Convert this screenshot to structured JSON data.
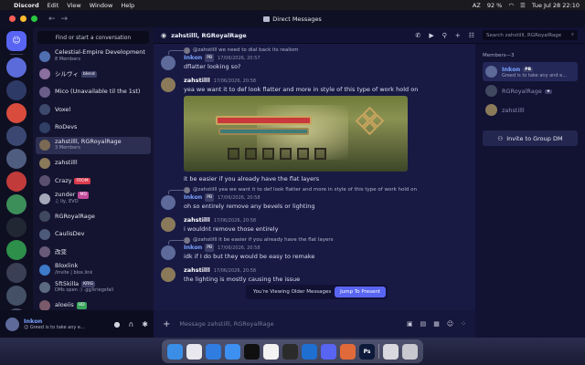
{
  "menubar": {
    "app": "Discord",
    "items": [
      "Edit",
      "View",
      "Window",
      "Help"
    ],
    "battery": "92 %",
    "input_source": "AZ",
    "datetime": "Tue Jul 28  22:10"
  },
  "window": {
    "title": "Direct Messages",
    "traffic": [
      "#ff5f57",
      "#febc2e",
      "#28c840"
    ]
  },
  "sidebar": {
    "find_label": "Find or start a conversation",
    "dms": [
      {
        "name": "Celestial-Empire Development",
        "sub": "8 Members",
        "color": "#4f6fb0"
      },
      {
        "name": "シルヴィ",
        "badge": "blend",
        "badge_style": "",
        "sub": "",
        "color": "#8b6f9e"
      },
      {
        "name": "Mico (Unavailable til the 1st)",
        "sub": "",
        "color": "#6a5d88"
      },
      {
        "name": "Voxel",
        "sub": "",
        "color": "#3d4a6e"
      },
      {
        "name": "RoDevs",
        "sub": "",
        "color": "#2f3f66"
      },
      {
        "name": "zahstilll, RGRoyalRage",
        "sub": "3 Members",
        "color": "#7a6a55"
      },
      {
        "name": "zahstilll",
        "sub": "",
        "color": "#8a7a5a"
      },
      {
        "name": "Crazy",
        "badge": "FROM",
        "badge_style": "red",
        "sub": "",
        "color": "#5a4f6f"
      },
      {
        "name": "zunder",
        "badge": "MD",
        "badge_style": "pink",
        "sub": "♫ Ily, EVO",
        "color": "#a5a8b8"
      },
      {
        "name": "RGRoyalRage",
        "sub": "",
        "color": "#404860"
      },
      {
        "name": "CaulisDev",
        "sub": "",
        "color": "#4d5a7a"
      },
      {
        "name": "改变",
        "sub": "",
        "color": "#6a5a7a"
      },
      {
        "name": "Bloxlink",
        "sub": "/invite | blox.link",
        "color": "#3d7ac9"
      },
      {
        "name": "5ft5killa",
        "badge": "KRIG",
        "badge_style": "",
        "sub": "DMs open :) .gg/kriegsfall",
        "color": "#5a6a80"
      },
      {
        "name": "aloeiis",
        "badge": "HD",
        "badge_style": "green",
        "sub": "",
        "color": "#7a5a6a"
      }
    ]
  },
  "guilds": [
    "#5b6bd9",
    "#2e3a66",
    "#d94c3d",
    "#3b4770",
    "#4f5d80",
    "#c23b3b",
    "#3d8f5a",
    "#222833",
    "#2d8f4a",
    "#3a3f55",
    "#445066",
    "#4a4f6a",
    "#2c2f44",
    "#58627d"
  ],
  "user": {
    "name": "Inkon",
    "status": "Greed is to take any e..."
  },
  "chat_header": {
    "title": "zahstilll, RGRoyalRage",
    "search_placeholder": "Search zahstilll, RGRoyalRage"
  },
  "messages": [
    {
      "reply": "@zahstilll we need to dial back its realism",
      "author": "Inkon",
      "author_blue": true,
      "badge": "PB",
      "ts": "17/06/2026, 20:57",
      "text": "dflatter looking so?",
      "av": "#5d6a9a"
    },
    {
      "author": "zahstilll",
      "ts": "17/06/2026, 20:58",
      "text": "yea we want it to def look flatter and more in style of this type of work hold on",
      "av": "#8a7a5a",
      "image": true,
      "after": "it be easier if you already have the flat layers"
    },
    {
      "reply": "@zahstilll yea we want it to def look flatter and more in style of this type of work hold on",
      "author": "Inkon",
      "author_blue": true,
      "badge": "PB",
      "ts": "17/06/2026, 20:58",
      "text": "oh so entirely remove any bevels or lighting",
      "av": "#5d6a9a"
    },
    {
      "author": "zahstilll",
      "ts": "17/06/2026, 20:58",
      "text": "i wouldnt remove those entirely",
      "av": "#8a7a5a"
    },
    {
      "reply": "@zahstilll it be easier if you already have the flat layers",
      "author": "Inkon",
      "author_blue": true,
      "badge": "PB",
      "ts": "17/06/2026, 20:58",
      "text": "idk if I do but they would be easy to remake",
      "av": "#5d6a9a"
    },
    {
      "author": "zahstilll",
      "ts": "17/06/2026, 20:58",
      "text": "the lighting is mostly causing the issue",
      "av": "#8a7a5a"
    }
  ],
  "toast": {
    "text": "You're Viewing Older Messages",
    "jump": "Jump To Present"
  },
  "composer": {
    "placeholder": "Message zahstilll, RGRoyalRage"
  },
  "members": {
    "header": "Members—3",
    "list": [
      {
        "name": "Inkon",
        "badge": "PB",
        "status": "Greed is to take any and e...",
        "color": "#5d6a9a",
        "dim": false
      },
      {
        "name": "RGRoyalRage",
        "badge": "★",
        "status": "",
        "color": "#404860",
        "dim": true
      },
      {
        "name": "zahstilll",
        "badge": "",
        "status": "",
        "color": "#8a7a5a",
        "dim": true
      }
    ],
    "invite": "Invite to Group DM"
  },
  "dock": [
    {
      "name": "finder",
      "color": "#3a8ee6",
      "glyph": ""
    },
    {
      "name": "launchpad",
      "color": "#e8e8ee",
      "glyph": ""
    },
    {
      "name": "safari",
      "color": "#2f7de0",
      "glyph": ""
    },
    {
      "name": "mail",
      "color": "#3d8ff0",
      "glyph": ""
    },
    {
      "name": "chatgpt",
      "color": "#101010",
      "glyph": ""
    },
    {
      "name": "photos",
      "color": "#f2f2f2",
      "glyph": ""
    },
    {
      "name": "roblox",
      "color": "#2b2b2b",
      "glyph": ""
    },
    {
      "name": "roblox-studio",
      "color": "#1f6fd1",
      "glyph": ""
    },
    {
      "name": "discord",
      "color": "#5865f2",
      "glyph": ""
    },
    {
      "name": "claude",
      "color": "#e06a3a",
      "glyph": ""
    },
    {
      "name": "photoshop",
      "color": "#0d1a3a",
      "glyph": "Ps"
    },
    {
      "name": "documents",
      "color": "#d8d8de",
      "glyph": ""
    },
    {
      "name": "trash",
      "color": "#c8c8d0",
      "glyph": ""
    }
  ]
}
